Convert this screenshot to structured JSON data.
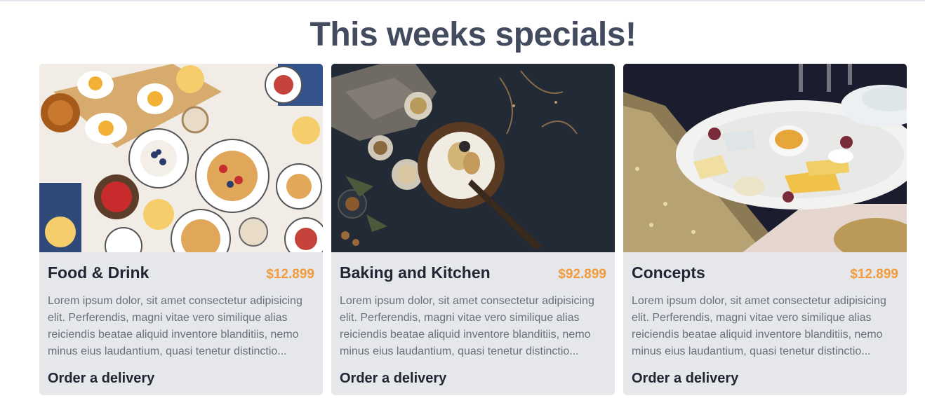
{
  "page": {
    "title": "This weeks specials!"
  },
  "cards": [
    {
      "title": "Food & Drink",
      "price": "$12.899",
      "description": "Lorem ipsum dolor, sit amet consectetur adipisicing elit. Perferendis, magni vitae vero similique alias reiciendis beatae aliquid inventore blanditiis, nemo minus eius laudantium, quasi tenetur distinctio...",
      "link": "Order a delivery",
      "image": "breakfast-table-photo"
    },
    {
      "title": "Baking and Kitchen",
      "price": "$92.899",
      "description": "Lorem ipsum dolor, sit amet consectetur adipisicing elit. Perferendis, magni vitae vero similique alias reiciendis beatae aliquid inventore blanditiis, nemo minus eius laudantium, quasi tenetur distinctio...",
      "link": "Order a delivery",
      "image": "cake-dark-table-photo"
    },
    {
      "title": "Concepts",
      "price": "$12.899",
      "description": "Lorem ipsum dolor, sit amet consectetur adipisicing elit. Perferendis, magni vitae vero similique alias reiciendis beatae aliquid inventore blanditiis, nemo minus eius laudantium, quasi tenetur distinctio...",
      "link": "Order a delivery",
      "image": "cheese-plate-photo"
    }
  ],
  "colors": {
    "title": "#434b5f",
    "card_background": "#e5e7eb",
    "price": "#f39a3c",
    "body_text": "#6b6f7b",
    "heading_text": "#1f2533"
  }
}
